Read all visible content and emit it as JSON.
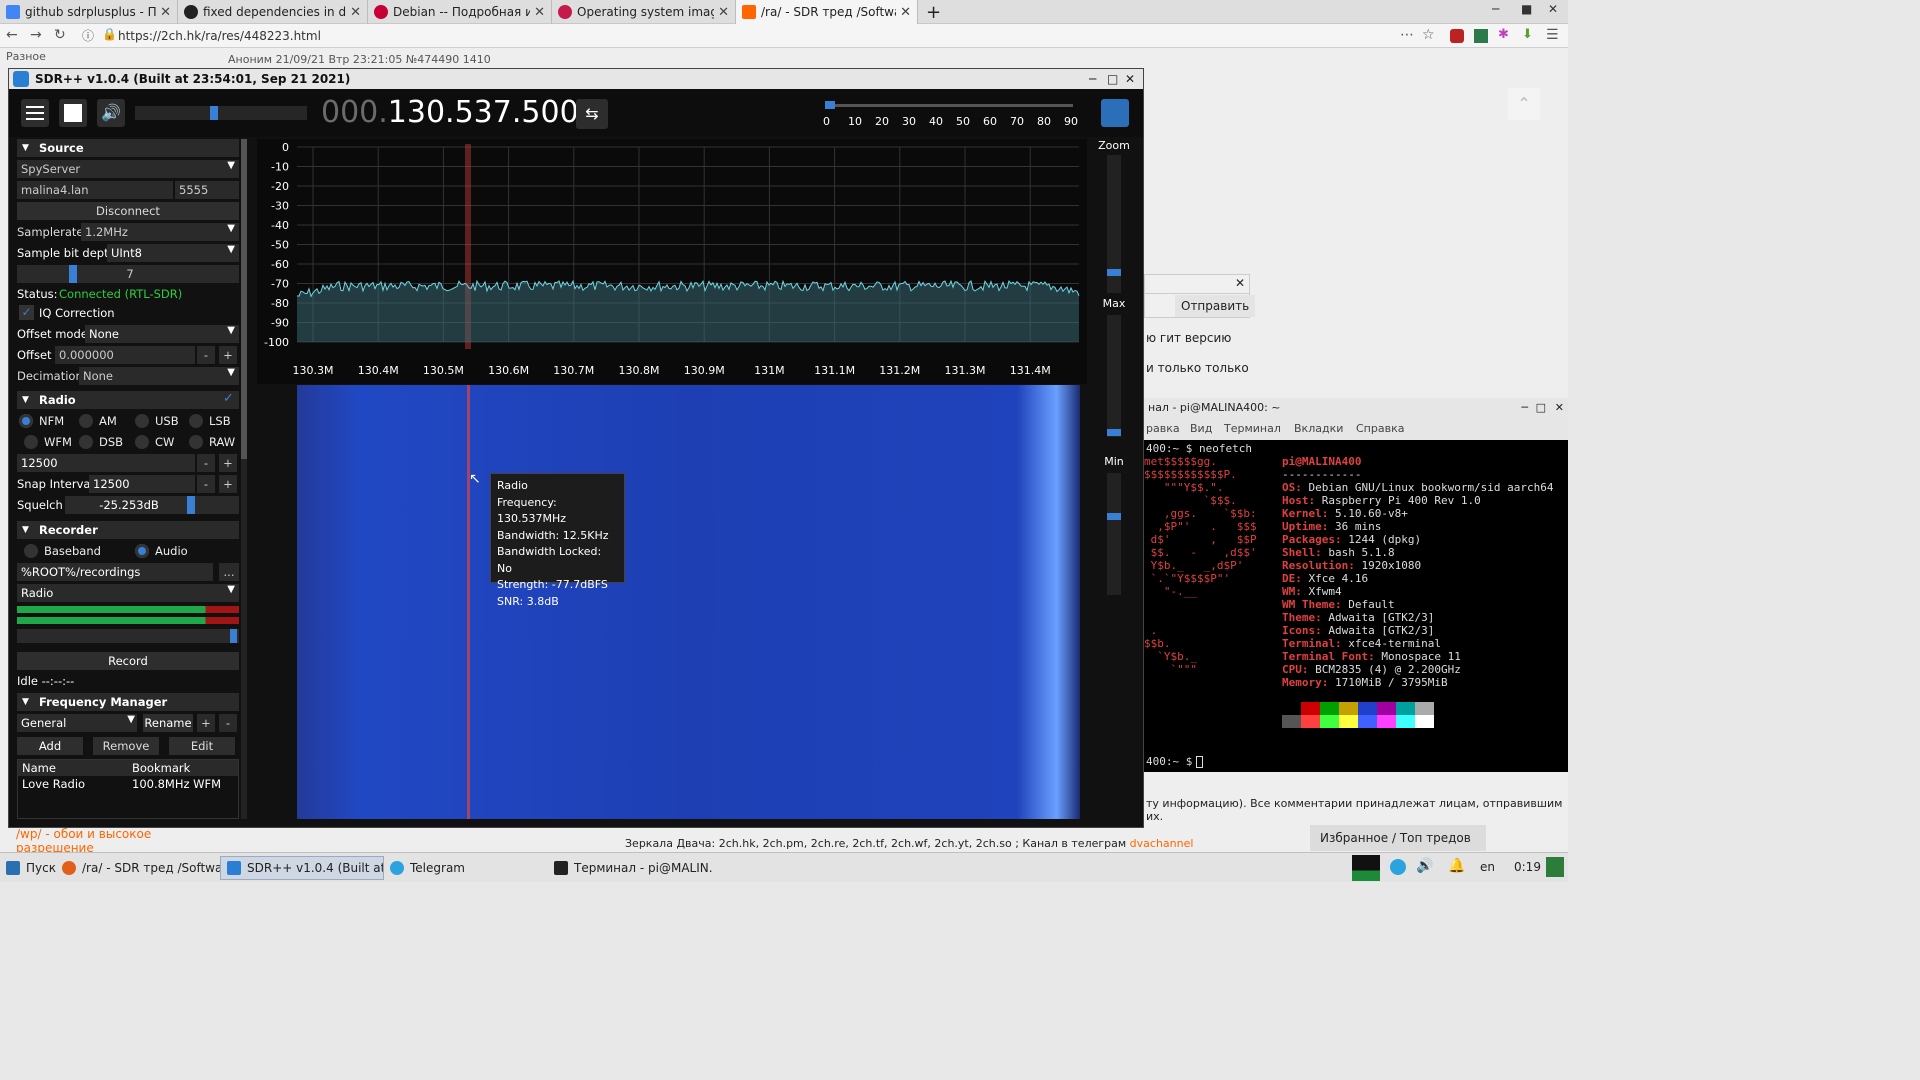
{
  "browser": {
    "tabs": [
      {
        "label": "github sdrplusplus - Пои",
        "color": "#4285f4"
      },
      {
        "label": "fixed dependencies in de",
        "color": "#222"
      },
      {
        "label": "Debian -- Подробная ин",
        "color": "#c70036"
      },
      {
        "label": "Operating system image",
        "color": "#c51a4a"
      },
      {
        "label": "/ra/ - SDR тред /Softwar",
        "color": "#ff6600"
      }
    ],
    "new_tab": "+",
    "url": "https://2ch.hk/ra/res/448223.html",
    "post_header": "Аноним 21/09/21 Втр 23:21:05 №474490 1410",
    "side_text": "Разное"
  },
  "sdr": {
    "title": "SDR++ v1.0.4 (Built at 23:54:01, Sep 21 2021)",
    "freq_dim": "000.",
    "freq_main": "130.537.500",
    "snr_ticks": [
      "0",
      "10",
      "20",
      "30",
      "40",
      "50",
      "60",
      "70",
      "80",
      "90"
    ],
    "zoom_label": "Zoom",
    "max_label": "Max",
    "min_label": "Min",
    "source": {
      "header": "Source",
      "type": "SpyServer",
      "host": "malina4.lan",
      "port": "5555",
      "disconnect": "Disconnect",
      "samplerate_label": "Samplerate",
      "samplerate": "1.2MHz",
      "bitdepth_label": "Sample bit depth",
      "bitdepth": "UInt8",
      "gain": "7",
      "status_label": "Status:",
      "status": "Connected (RTL-SDR)",
      "iq": "IQ Correction",
      "offset_mode_label": "Offset mode",
      "offset_mode": "None",
      "offset_label": "Offset",
      "offset": "0.000000",
      "decimation_label": "Decimation",
      "decimation": "None"
    },
    "radio": {
      "header": "Radio",
      "modes": [
        "NFM",
        "AM",
        "USB",
        "LSB",
        "WFM",
        "DSB",
        "CW",
        "RAW"
      ],
      "bandwidth": "12500",
      "snap_label": "Snap Interval",
      "snap": "12500",
      "squelch_label": "Squelch",
      "squelch": "-25.253dB"
    },
    "recorder": {
      "header": "Recorder",
      "baseband": "Baseband",
      "audio": "Audio",
      "path": "%ROOT%/recordings",
      "browse": "...",
      "stream": "Radio",
      "record": "Record",
      "idle": "Idle --:--:--"
    },
    "fm": {
      "header": "Frequency Manager",
      "list": "General",
      "rename": "Rename",
      "add": "Add",
      "remove": "Remove",
      "edit": "Edit",
      "col_name": "Name",
      "col_bookmark": "Bookmark",
      "rows": [
        {
          "name": "Love Radio",
          "bookmark": "100.8MHz WFM"
        }
      ]
    },
    "fft_y": [
      "0",
      "-10",
      "-20",
      "-30",
      "-40",
      "-50",
      "-60",
      "-70",
      "-80",
      "-90",
      "-100"
    ],
    "fft_x": [
      "130.3M",
      "130.4M",
      "130.5M",
      "130.6M",
      "130.7M",
      "130.8M",
      "130.9M",
      "131M",
      "131.1M",
      "131.2M",
      "131.3M",
      "131.4M"
    ],
    "tooltip": {
      "title": "Radio",
      "frequency": "Frequency: 130.537MHz",
      "bandwidth": "Bandwidth: 12.5KHz",
      "locked": "Bandwidth Locked: No",
      "strength": "Strength: -77.7dBFS",
      "snr": "SNR: 3.8dB"
    }
  },
  "page": {
    "send": "Отправить",
    "git_text": "ю гит версию",
    "only_text": "и только только",
    "footer_note": "ту информацию). Все комментарии принадлежат лицам, отправившим их.",
    "mirrors": "Зеркала Двача: 2ch.hk, 2ch.pm, 2ch.re, 2ch.tf, 2ch.wf, 2ch.yt, 2ch.so ; Канал в телеграм",
    "channel": "dvachannel",
    "wp": "/wp/ - обои и высокое",
    "wp2": "разрешение",
    "favorites": "Избранное / Топ тредов"
  },
  "terminal": {
    "title": "нал - pi@MALINA400: ~",
    "menu": [
      "равка",
      "Вид",
      "Терминал",
      "Вкладки",
      "Справка"
    ],
    "prompt1": "400:~ $ neofetch",
    "logo": [
      "met$$$$$gg.",
      "$$$$$$$$$$$$P.",
      "   \"\"\"Y$$.\".",
      "         `$$$.",
      "   ,ggs.    `$$b:",
      "  ,$P\"'   .   $$$",
      " d$'      ,   $$P",
      " $$.   -    ,d$$'",
      " Y$b._   _,d$P'",
      " `.`\"Y$$$$P\"'",
      "   \"-.__",
      "",
      "",
      " .",
      "$$b.",
      "  `Y$b._",
      "    `\"\"\""
    ],
    "user": "pi@MALINA400",
    "sep": "------------",
    "info": [
      [
        "OS:",
        "Debian GNU/Linux bookworm/sid aarch64"
      ],
      [
        "Host:",
        "Raspberry Pi 400 Rev 1.0"
      ],
      [
        "Kernel:",
        "5.10.60-v8+"
      ],
      [
        "Uptime:",
        "36 mins"
      ],
      [
        "Packages:",
        "1244 (dpkg)"
      ],
      [
        "Shell:",
        "bash 5.1.8"
      ],
      [
        "Resolution:",
        "1920x1080"
      ],
      [
        "DE:",
        "Xfce 4.16"
      ],
      [
        "WM:",
        "Xfwm4"
      ],
      [
        "WM Theme:",
        "Default"
      ],
      [
        "Theme:",
        "Adwaita [GTK2/3]"
      ],
      [
        "Icons:",
        "Adwaita [GTK2/3]"
      ],
      [
        "Terminal:",
        "xfce4-terminal"
      ],
      [
        "Terminal Font:",
        "Monospace 11"
      ],
      [
        "CPU:",
        "BCM2835 (4) @ 2.200GHz"
      ],
      [
        "Memory:",
        "1710MiB / 3795MiB"
      ]
    ],
    "palette1": [
      "#000000",
      "#cc0000",
      "#00a000",
      "#c4a000",
      "#2040cc",
      "#a000a0",
      "#00a0a0",
      "#aaaaaa"
    ],
    "palette2": [
      "#555555",
      "#ff4040",
      "#40ff40",
      "#ffff40",
      "#4060ff",
      "#ff40ff",
      "#40ffff",
      "#ffffff"
    ],
    "prompt2": "400:~ $"
  },
  "taskbar": {
    "start": "Пуск",
    "items": [
      "/ra/ - SDR тред /Softwar...",
      "SDR++ v1.0.4 (Built at ...",
      "Telegram",
      "Терминал - pi@MALIN..."
    ],
    "lang": "en",
    "clock": "0:19"
  }
}
